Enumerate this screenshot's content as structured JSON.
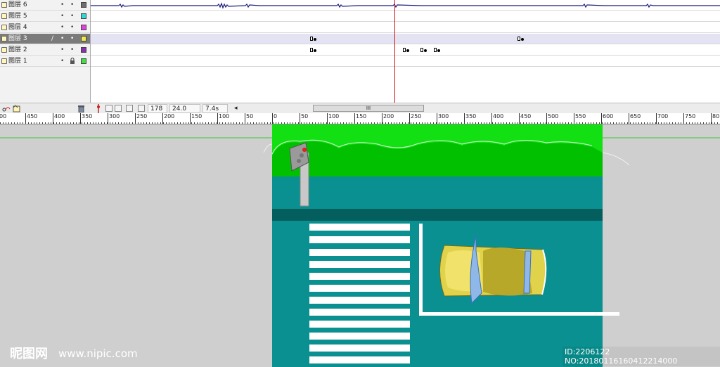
{
  "layers": [
    {
      "name": "图层 6",
      "eye": "•",
      "lock": "•",
      "color": "#6e6e6e",
      "selected": false,
      "locked": false
    },
    {
      "name": "图层 5",
      "eye": "•",
      "lock": "•",
      "color": "#33d6d6",
      "selected": false,
      "locked": false
    },
    {
      "name": "图层 4",
      "eye": "•",
      "lock": "•",
      "color": "#e040e0",
      "selected": false,
      "locked": false
    },
    {
      "name": "图层 3",
      "eye": "•",
      "lock": "•",
      "color": "#f2ea4a",
      "selected": true,
      "locked": false
    },
    {
      "name": "图层 2",
      "eye": "•",
      "lock": "•",
      "color": "#8a2fb0",
      "selected": false,
      "locked": false
    },
    {
      "name": "图层 1",
      "eye": "•",
      "lock": "",
      "color": "#40e040",
      "selected": false,
      "locked": true
    }
  ],
  "timeline_status": {
    "current_frame": "178",
    "frame_rate": "24.0 fps",
    "elapsed_time": "7.4s",
    "scroll_grip": "III",
    "scroll_left_arrow": "◂"
  },
  "ruler": {
    "left_labels": [
      "00",
      "450",
      "400",
      "350",
      "300",
      "250",
      "200",
      "150",
      "100",
      "50"
    ],
    "right_labels": [
      "0",
      "50",
      "100",
      "150",
      "200",
      "250",
      "300",
      "350",
      "400",
      "450",
      "500",
      "550",
      "600",
      "650",
      "700",
      "750",
      "80"
    ]
  },
  "watermark": {
    "logo": "昵图网",
    "site": "www.nipic.com",
    "image_id": "ID:2206122 NO:20180116160412214000"
  },
  "colors": {
    "stage_teal": "#0a9090",
    "grass": "#12e012",
    "bushes": "#00c000",
    "car_body": "#e0d24a",
    "car_glass": "#8fb8e8"
  }
}
